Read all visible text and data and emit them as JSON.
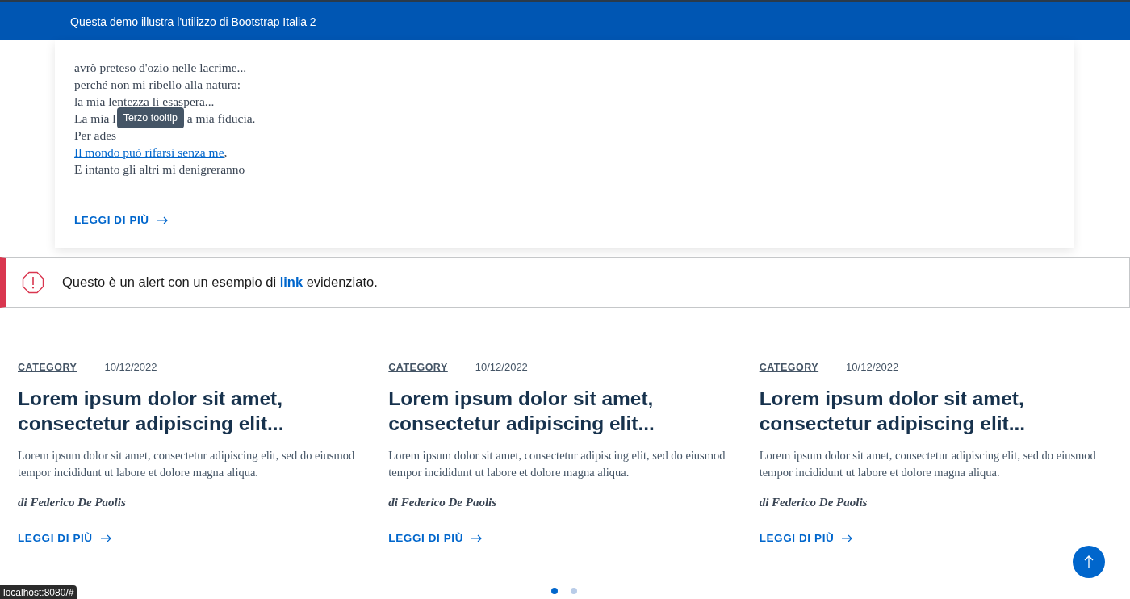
{
  "top_bar": {
    "text": "Questa demo illustra l'utilizzo di Bootstrap Italia 2"
  },
  "poem_card": {
    "lines": [
      {
        "parts": [
          "avrò preteso d'ozio nelle lacrime..."
        ]
      },
      {
        "parts": [
          "perché non mi ribello alla natura:"
        ]
      },
      {
        "parts": [
          "la mia lentezza li esaspera..."
        ]
      },
      {
        "parts": [
          "La mia l",
          "a mia fiducia."
        ]
      },
      {
        "parts": [
          "Per ades"
        ]
      },
      {
        "parts": [
          "Il mondo può rifarsi senza me"
        ],
        "link": true,
        "trail": ","
      },
      {
        "parts": [
          "E intanto gli altri mi denigreranno"
        ]
      }
    ],
    "tooltip": "Terzo tooltip",
    "read_more": "LEGGI DI PIÙ"
  },
  "alert": {
    "text_before": "Questo è un alert con un esempio di",
    "link": "link",
    "text_after": "evidenziato."
  },
  "articles": [
    {
      "category": "CATEGORY",
      "date": "10/12/2022",
      "title": "Lorem ipsum dolor sit amet, consectetur adipiscing elit...",
      "body": "Lorem ipsum dolor sit amet, consectetur adipiscing elit, sed do eiusmod tempor incididunt ut labore et dolore magna aliqua.",
      "author": "di Federico De Paolis",
      "read_more": "LEGGI DI PIÙ"
    },
    {
      "category": "CATEGORY",
      "date": "10/12/2022",
      "title": "Lorem ipsum dolor sit amet, consectetur adipiscing elit...",
      "body": "Lorem ipsum dolor sit amet, consectetur adipiscing elit, sed do eiusmod tempor incididunt ut labore et dolore magna aliqua.",
      "author": "di Federico De Paolis",
      "read_more": "LEGGI DI PIÙ"
    },
    {
      "category": "CATEGORY",
      "date": "10/12/2022",
      "title": "Lorem ipsum dolor sit amet, consectetur adipiscing elit...",
      "body": "Lorem ipsum dolor sit amet, consectetur adipiscing elit, sed do eiusmod tempor incididunt ut labore et dolore magna aliqua.",
      "author": "di Federico De Paolis",
      "read_more": "LEGGI DI PIÙ"
    }
  ],
  "pagination": [
    {
      "selected": true
    },
    {
      "selected": false
    }
  ],
  "status_url": "localhost:8080/#"
}
